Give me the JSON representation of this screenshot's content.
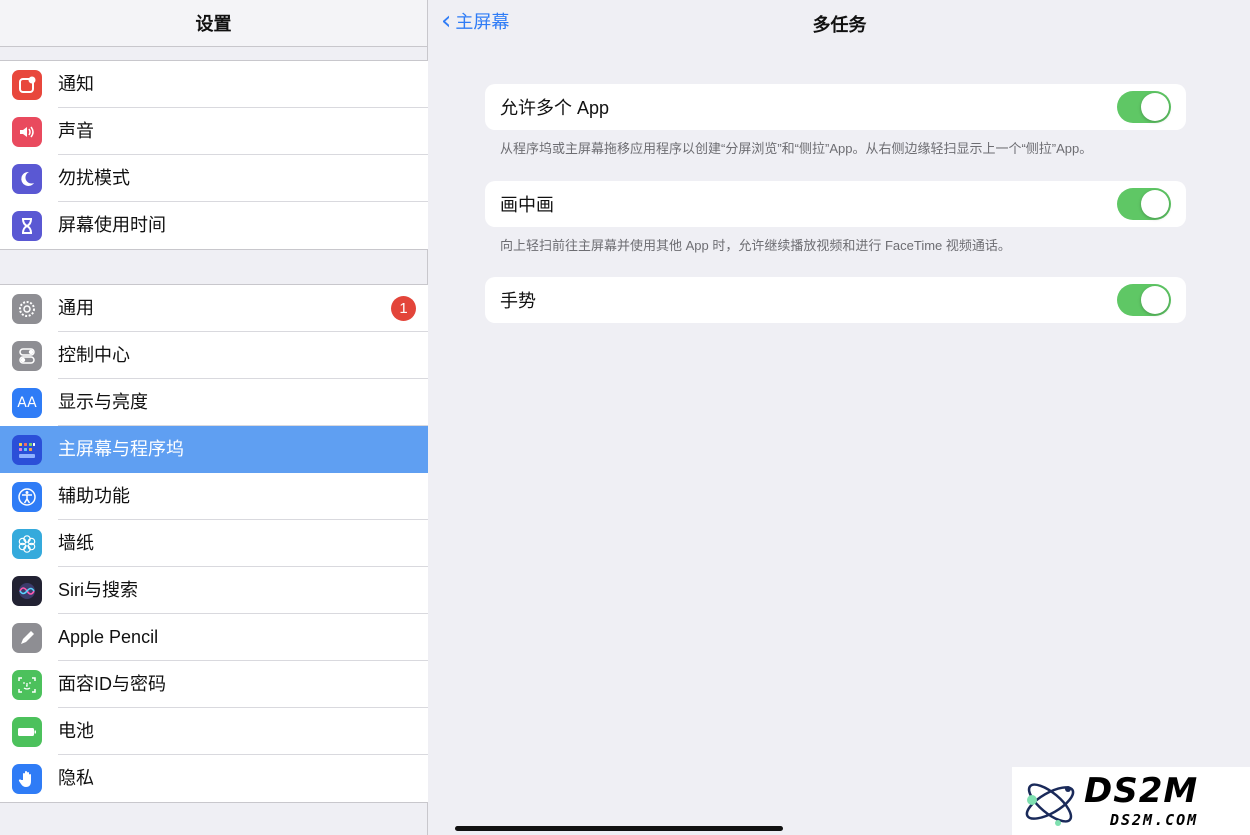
{
  "sidebar": {
    "title": "设置",
    "group1": [
      {
        "label": "通知",
        "icon": "notification-icon",
        "color": "#e8473c"
      },
      {
        "label": "声音",
        "icon": "speaker-icon",
        "color": "#e94a5e"
      },
      {
        "label": "勿扰模式",
        "icon": "moon-icon",
        "color": "#5a58d3"
      },
      {
        "label": "屏幕使用时间",
        "icon": "hourglass-icon",
        "color": "#5a58d3"
      }
    ],
    "group2": [
      {
        "label": "通用",
        "icon": "gear-icon",
        "color": "#8e8e93",
        "badge": "1"
      },
      {
        "label": "控制中心",
        "icon": "toggles-icon",
        "color": "#8e8e93"
      },
      {
        "label": "显示与亮度",
        "icon": "text-size-icon",
        "color": "#2f7cf6",
        "glyph": "AA"
      },
      {
        "label": "主屏幕与程序坞",
        "icon": "home-screen-icon",
        "color": "#2b4fd8",
        "selected": true
      },
      {
        "label": "辅助功能",
        "icon": "accessibility-icon",
        "color": "#2f7cf6"
      },
      {
        "label": "墙纸",
        "icon": "flower-icon",
        "color": "#35aadc"
      },
      {
        "label": "Siri与搜索",
        "icon": "siri-icon",
        "color": "#222233"
      },
      {
        "label": "Apple Pencil",
        "icon": "pencil-icon",
        "color": "#8e8e93"
      },
      {
        "label": "面容ID与密码",
        "icon": "face-id-icon",
        "color": "#4cc15c"
      },
      {
        "label": "电池",
        "icon": "battery-icon",
        "color": "#4cc15c"
      },
      {
        "label": "隐私",
        "icon": "hand-icon",
        "color": "#2f7cf6"
      }
    ]
  },
  "detail": {
    "back_label": "主屏幕",
    "title": "多任务",
    "settings": [
      {
        "label": "允许多个 App",
        "on": true,
        "footnote": "从程序坞或主屏幕拖移应用程序以创建“分屏浏览”和“侧拉”App。从右侧边缘轻扫显示上一个“侧拉”App。"
      },
      {
        "label": "画中画",
        "on": true,
        "footnote": "向上轻扫前往主屏幕并使用其他 App 时，允许继续播放视频和进行 FaceTime 视频通话。"
      },
      {
        "label": "手势",
        "on": true,
        "footnote": ""
      }
    ]
  },
  "colors": {
    "toggle_on": "#5fc765",
    "selected_row": "#5f9ff2",
    "accent": "#2f7cf6"
  },
  "watermark": {
    "big": "DS2M",
    "small": "DS2M.COM"
  }
}
